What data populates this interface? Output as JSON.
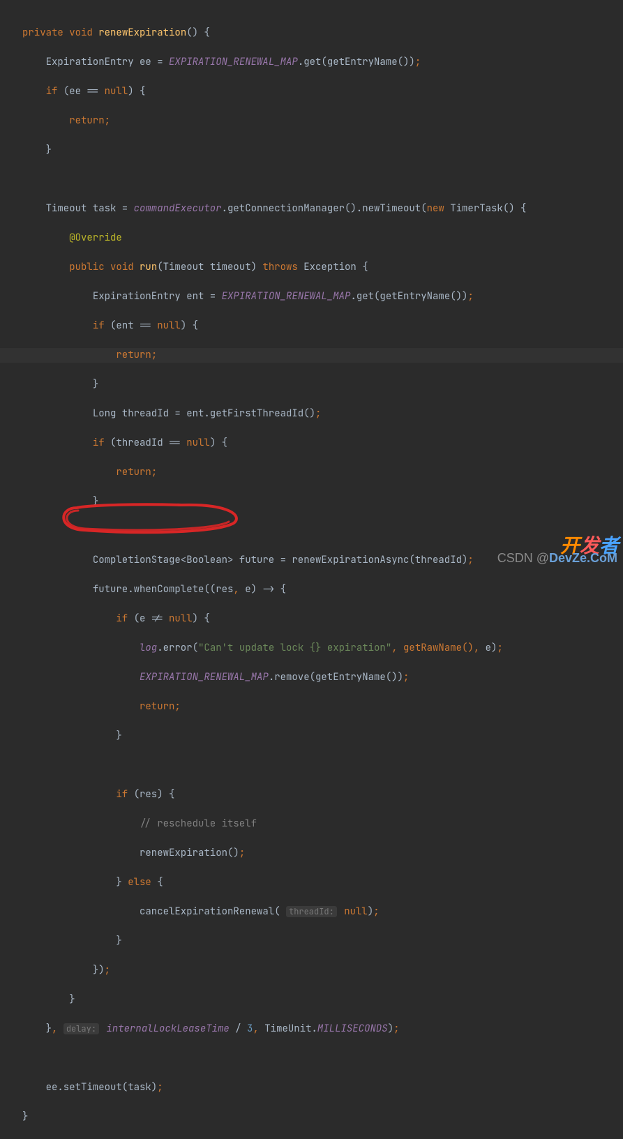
{
  "code": {
    "l1_kw1": "private",
    "l1_kw2": "void",
    "l1_name": "renewExpiration",
    "l1_rest": "() {",
    "l2_a": "ExpirationEntry ee = ",
    "l2_map": "EXPIRATION_RENEWAL_MAP",
    "l2_b": ".get(getEntryName())",
    "l2_sc": ";",
    "l3_if": "if ",
    "l3_a": "(ee == ",
    "l3_null": "null",
    "l3_b": ") {",
    "l4_ret": "return",
    "l4_sc": ";",
    "l5": "}",
    "l7_a": "Timeout task = ",
    "l7_ce": "commandExecutor",
    "l7_b": ".getConnectionManager().newTimeout(",
    "l7_new": "new ",
    "l7_c": "TimerTask() {",
    "l8_ann": "@Override",
    "l9_pub": "public ",
    "l9_void": "void ",
    "l9_run": "run",
    "l9_a": "(Timeout timeout) ",
    "l9_throws": "throws ",
    "l9_b": "Exception {",
    "l10_a": "ExpirationEntry ent = ",
    "l10_map": "EXPIRATION_RENEWAL_MAP",
    "l10_b": ".get(getEntryName())",
    "l10_sc": ";",
    "l11_if": "if ",
    "l11_a": "(ent == ",
    "l11_null": "null",
    "l11_b": ") {",
    "l12_ret": "return",
    "l12_sc": ";",
    "l13": "}",
    "l14_a": "Long threadId = ent.getFirstThreadId()",
    "l14_sc": ";",
    "l15_if": "if ",
    "l15_a": "(threadId == ",
    "l15_null": "null",
    "l15_b": ") {",
    "l16_ret": "return",
    "l16_sc": ";",
    "l17": "}",
    "l19_a": "CompletionStage<Boolean> future = renewExpirationAsync(threadId)",
    "l19_sc": ";",
    "l20_a": "future.whenComplete((res",
    "l20_c": ", ",
    "l20_b": "e) -> {",
    "l21_if": "if ",
    "l21_a": "(e != ",
    "l21_null": "null",
    "l21_b": ") {",
    "l22_log": "log",
    "l22_a": ".error(",
    "l22_str": "\"Can't update lock {} expiration\"",
    "l22_b": ", getRawName()",
    "l22_c": ", ",
    "l22_d": "e)",
    "l22_sc": ";",
    "l23_map": "EXPIRATION_RENEWAL_MAP",
    "l23_a": ".remove(getEntryName())",
    "l23_sc": ";",
    "l24_ret": "return",
    "l24_sc": ";",
    "l25": "}",
    "l27_if": "if ",
    "l27_a": "(res) {",
    "l28_cmt": "// reschedule itself",
    "l29_a": "renewExpiration()",
    "l29_sc": ";",
    "l30_a": "} ",
    "l30_else": "else ",
    "l30_b": "{",
    "l31_a": "cancelExpirationRenewal( ",
    "l31_hint": "threadId:",
    "l31_null": "null",
    "l31_b": ")",
    "l31_sc": ";",
    "l32": "}",
    "l33_a": "})",
    "l33_sc": ";",
    "l34": "}",
    "l35_a": "}",
    "l35_c": ", ",
    "l35_hint": "delay:",
    "l35_var": "internalLockLeaseTime",
    "l35_b": " / ",
    "l35_num": "3",
    "l35_d": ", ",
    "l35_e": "TimeUnit.",
    "l35_ms": "MILLISECONDS",
    "l35_f": ")",
    "l35_sc": ";",
    "l37_a": "ee.setTimeout(task)",
    "l37_sc": ";",
    "l38": "}"
  },
  "watermark": "CSDN @",
  "logo": {
    "a": "开",
    "b": "发",
    "c": "者",
    "d": "DevZe.CoM"
  }
}
